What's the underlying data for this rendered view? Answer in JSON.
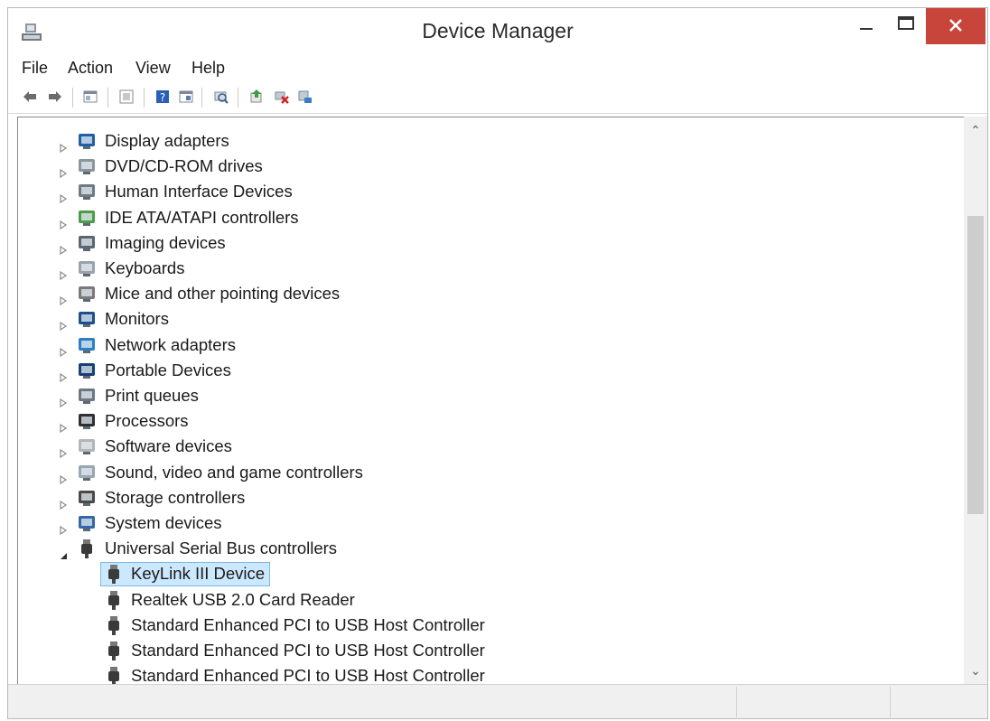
{
  "window": {
    "title": "Device Manager"
  },
  "colors": {
    "close": "#c7453a",
    "selection": "#cce8ff",
    "selection_border": "#79b8e6"
  },
  "icons": {
    "app": "device-manager-icon",
    "controls": [
      "minimize-icon",
      "maximize-icon",
      "close-icon"
    ],
    "toolbar": [
      "back-icon",
      "forward-icon",
      "properties-icon",
      "show-hidden-icon",
      "help-icon",
      "show-hide-console-tree-icon",
      "scan-hardware-icon",
      "update-driver-icon",
      "disable-device-icon",
      "uninstall-device-icon"
    ]
  },
  "menu": [
    "File",
    "Action",
    "View",
    "Help"
  ],
  "tree": {
    "categories": [
      {
        "label": "Display adapters",
        "icon": "display-adapter-icon"
      },
      {
        "label": "DVD/CD-ROM drives",
        "icon": "dvd-drive-icon"
      },
      {
        "label": "Human Interface Devices",
        "icon": "hid-icon"
      },
      {
        "label": "IDE ATA/ATAPI controllers",
        "icon": "ide-controller-icon"
      },
      {
        "label": "Imaging devices",
        "icon": "imaging-device-icon"
      },
      {
        "label": "Keyboards",
        "icon": "keyboard-icon"
      },
      {
        "label": "Mice and other pointing devices",
        "icon": "mouse-icon"
      },
      {
        "label": "Monitors",
        "icon": "monitor-icon"
      },
      {
        "label": "Network adapters",
        "icon": "network-adapter-icon"
      },
      {
        "label": "Portable Devices",
        "icon": "portable-device-icon"
      },
      {
        "label": "Print queues",
        "icon": "printer-icon"
      },
      {
        "label": "Processors",
        "icon": "processor-icon"
      },
      {
        "label": "Software devices",
        "icon": "software-device-icon"
      },
      {
        "label": "Sound, video and game controllers",
        "icon": "sound-icon"
      },
      {
        "label": "Storage controllers",
        "icon": "storage-controller-icon"
      },
      {
        "label": "System devices",
        "icon": "system-device-icon"
      },
      {
        "label": "Universal Serial Bus controllers",
        "icon": "usb-icon",
        "expanded": true
      }
    ],
    "usb_children": [
      {
        "label": "KeyLink III Device",
        "selected": true
      },
      {
        "label": "Realtek USB 2.0 Card Reader"
      },
      {
        "label": "Standard Enhanced PCI to USB Host Controller"
      },
      {
        "label": "Standard Enhanced PCI to USB Host Controller"
      },
      {
        "label": "Standard Enhanced PCI to USB Host Controller"
      }
    ]
  }
}
